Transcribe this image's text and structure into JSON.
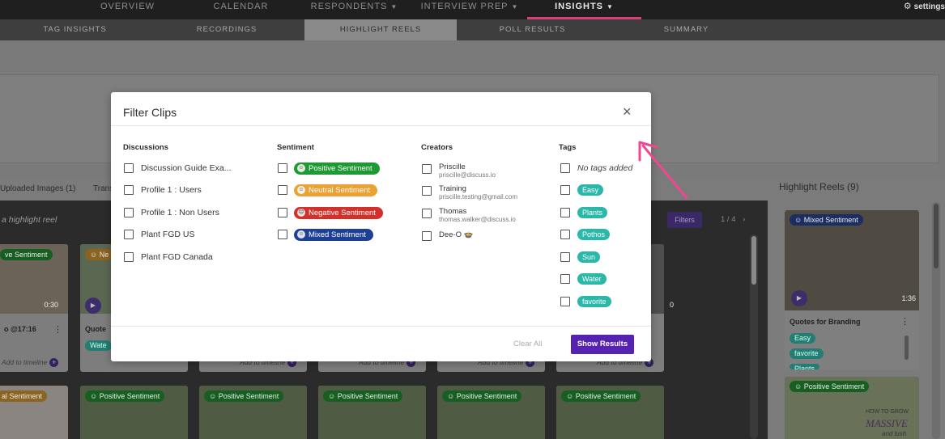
{
  "topnav": {
    "items": [
      {
        "label": "OVERVIEW"
      },
      {
        "label": "CALENDAR"
      },
      {
        "label": "RESPONDENTS"
      },
      {
        "label": "INTERVIEW PREP"
      },
      {
        "label": "INSIGHTS"
      }
    ],
    "settings": "settings"
  },
  "subnav": {
    "items": [
      {
        "label": "TAG INSIGHTS"
      },
      {
        "label": "RECORDINGS"
      },
      {
        "label": "HIGHLIGHT REELS"
      },
      {
        "label": "POLL RESULTS"
      },
      {
        "label": "SUMMARY"
      }
    ]
  },
  "background": {
    "tab_uploaded": "Uploaded Images (1)",
    "tab_trans": "Trans",
    "reel_hint": "a highlight reel",
    "filters": "Filters",
    "pager": "1 / 4",
    "cards_top": [
      {
        "badge": "ve Sentiment",
        "time": "0:30",
        "title": "o @17:16",
        "add": "Add to timeline"
      },
      {
        "badge": "Ne",
        "title": "Quote",
        "tag": "Wate"
      },
      {
        "add": "Add to timeline"
      },
      {
        "add": "Add to timeline"
      },
      {
        "add": "Add to timeline"
      },
      {
        "add": "Add to timeline"
      },
      {
        "time": "0"
      }
    ],
    "cards_bottom": [
      {
        "badge": "al Sentiment"
      },
      {
        "badge": "Positive Sentiment"
      },
      {
        "badge": "Positive Sentiment"
      },
      {
        "badge": "Positive Sentiment"
      },
      {
        "badge": "Positive Sentiment"
      },
      {
        "badge": "Positive Sentiment"
      },
      {
        "badge": "Positive Sentiment"
      }
    ],
    "highlight_reels": {
      "title": "Highlight Reels (9)",
      "card1": {
        "badge": "Mixed Sentiment",
        "time": "1:36",
        "title": "Quotes for Branding",
        "tags": [
          "Easy",
          "favorite",
          "Plants"
        ]
      },
      "card2": {
        "badge": "Positive Sentiment",
        "thumb_text_1": "HOW TO GROW",
        "thumb_text_2": "MASSIVE",
        "thumb_text_3": "and lush"
      }
    }
  },
  "modal": {
    "title": "Filter Clips",
    "close": "×",
    "discussions": {
      "heading": "Discussions",
      "items": [
        "Discussion Guide Exa...",
        "Profile 1 : Users",
        "Profile 1 : Non Users",
        "Plant FGD US",
        "Plant FGD Canada"
      ]
    },
    "sentiment": {
      "heading": "Sentiment",
      "items": [
        {
          "label": "Positive Sentiment",
          "color": "#1e9a33"
        },
        {
          "label": "Neutral Sentiment",
          "color": "#e9a233"
        },
        {
          "label": "Negative Sentiment",
          "color": "#d2302b"
        },
        {
          "label": "Mixed Sentiment",
          "color": "#1d3f96"
        }
      ]
    },
    "creators": {
      "heading": "Creators",
      "items": [
        {
          "name": "Priscille",
          "email": "priscille@discuss.io"
        },
        {
          "name": "Training",
          "email": "priscille.testing@gmail.com"
        },
        {
          "name": "Thomas",
          "email": "thomas.walker@discuss.io"
        },
        {
          "name": "Dee-O 🍲",
          "email": ""
        }
      ]
    },
    "tags": {
      "heading": "Tags",
      "no_tags": "No tags added",
      "items": [
        "Easy",
        "Plants",
        "Pothos",
        "Sun",
        "Water",
        "favorite"
      ]
    },
    "clear_all": "Clear All",
    "show_results": "Show Results"
  }
}
